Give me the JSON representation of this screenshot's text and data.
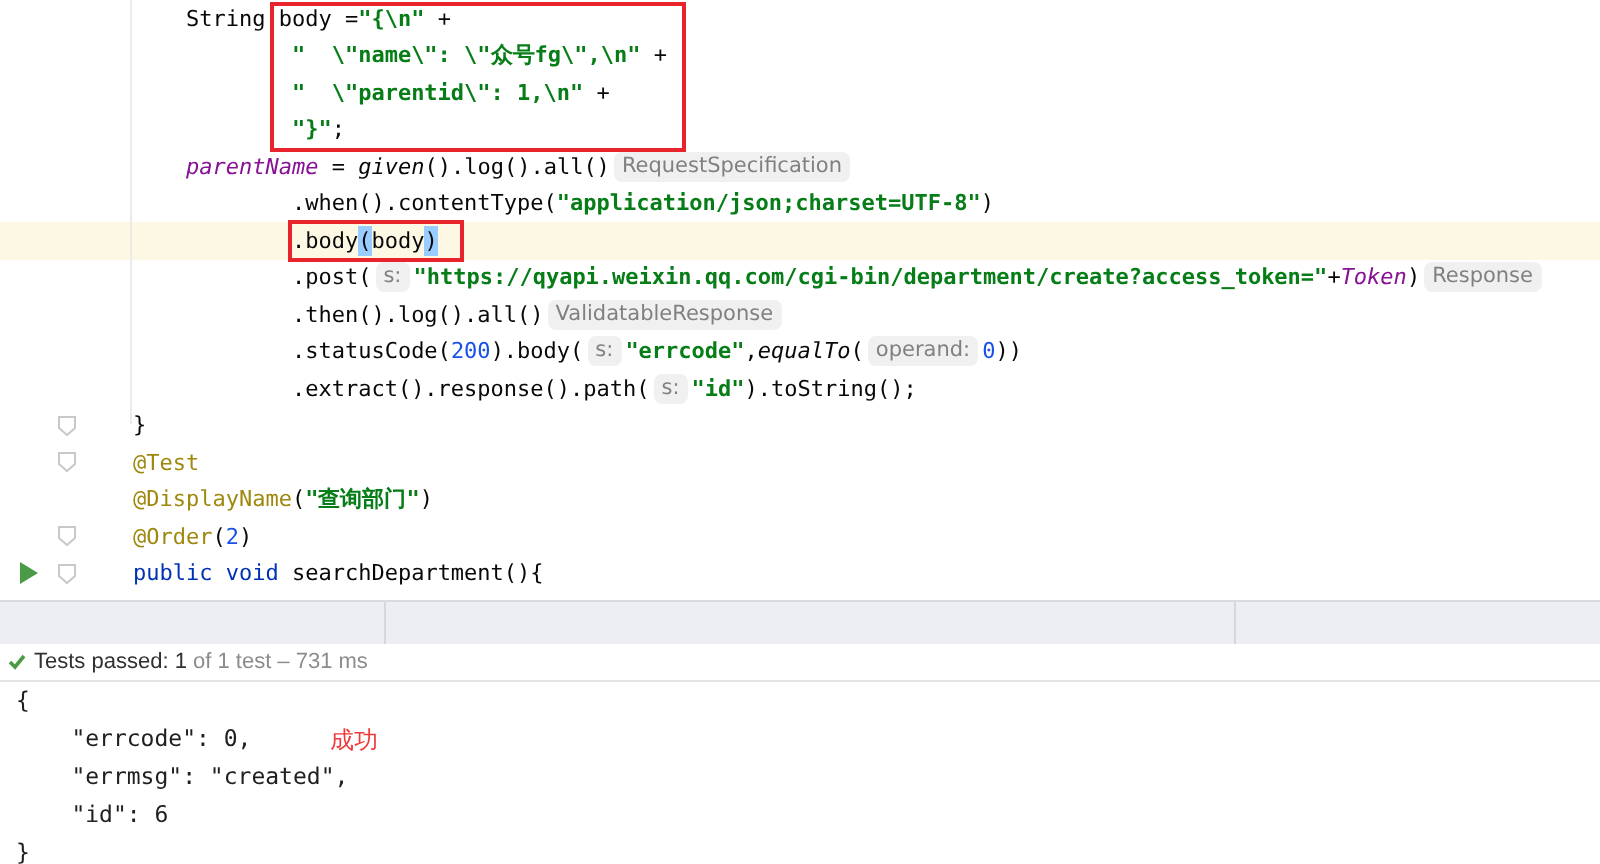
{
  "editor": {
    "lines": [
      {
        "tokens": [
          {
            "kind": "plain",
            "text": "        String body ="
          },
          {
            "kind": "string",
            "text": "\"{\\n\""
          },
          {
            "kind": "plain",
            "text": " +"
          }
        ]
      },
      {
        "tokens": [
          {
            "kind": "string",
            "text": "                \"  \\\"name\\\": \\\"众号fg\\\",\\n\""
          },
          {
            "kind": "plain",
            "text": " +"
          }
        ]
      },
      {
        "tokens": [
          {
            "kind": "string",
            "text": "                \"  \\\"parentid\\\": 1,\\n\""
          },
          {
            "kind": "plain",
            "text": " +"
          }
        ]
      },
      {
        "tokens": [
          {
            "kind": "string",
            "text": "                \"}\""
          },
          {
            "kind": "plain",
            "text": ";"
          }
        ]
      },
      {
        "tokens": [
          {
            "kind": "field",
            "text": "        parentName"
          },
          {
            "kind": "plain",
            "text": " = "
          },
          {
            "kind": "call",
            "text": "given"
          },
          {
            "kind": "plain",
            "text": "().log().all()"
          },
          {
            "kind": "hint",
            "text": "RequestSpecification"
          }
        ]
      },
      {
        "tokens": [
          {
            "kind": "plain",
            "text": "                .when().contentType("
          },
          {
            "kind": "string",
            "text": "\"application/json;charset=UTF-8\""
          },
          {
            "kind": "plain",
            "text": ")"
          }
        ]
      },
      {
        "current": true,
        "tokens": [
          {
            "kind": "plain",
            "text": "                .body"
          },
          {
            "kind": "match",
            "text": "("
          },
          {
            "kind": "plain",
            "text": "body"
          },
          {
            "kind": "match",
            "text": ")"
          }
        ]
      },
      {
        "tokens": [
          {
            "kind": "plain",
            "text": "                .post("
          },
          {
            "kind": "hint",
            "text": "s:"
          },
          {
            "kind": "string",
            "text": "\"https://qyapi.weixin.qq.com/cgi-bin/department/create?access_token=\""
          },
          {
            "kind": "plain",
            "text": "+"
          },
          {
            "kind": "field",
            "text": "Token"
          },
          {
            "kind": "plain",
            "text": ")"
          },
          {
            "kind": "hint",
            "text": "Response"
          }
        ]
      },
      {
        "tokens": [
          {
            "kind": "plain",
            "text": "                .then().log().all()"
          },
          {
            "kind": "hint",
            "text": "ValidatableResponse"
          }
        ]
      },
      {
        "tokens": [
          {
            "kind": "plain",
            "text": "                .statusCode("
          },
          {
            "kind": "number",
            "text": "200"
          },
          {
            "kind": "plain",
            "text": ").body("
          },
          {
            "kind": "hint",
            "text": "s:"
          },
          {
            "kind": "string",
            "text": "\"errcode\""
          },
          {
            "kind": "plain",
            "text": ","
          },
          {
            "kind": "call",
            "text": "equalTo"
          },
          {
            "kind": "plain",
            "text": "("
          },
          {
            "kind": "hint",
            "text": "operand:"
          },
          {
            "kind": "number",
            "text": "0"
          },
          {
            "kind": "plain",
            "text": "))"
          }
        ]
      },
      {
        "tokens": [
          {
            "kind": "plain",
            "text": "                .extract().response().path("
          },
          {
            "kind": "hint",
            "text": "s:"
          },
          {
            "kind": "string",
            "text": "\"id\""
          },
          {
            "kind": "plain",
            "text": ").toString();"
          }
        ]
      },
      {
        "foldable": true,
        "tokens": [
          {
            "kind": "plain",
            "text": "    }"
          }
        ]
      },
      {
        "foldable": true,
        "tokens": [
          {
            "kind": "annotation",
            "text": "    @Test"
          }
        ]
      },
      {
        "tokens": [
          {
            "kind": "annotation",
            "text": "    @DisplayName"
          },
          {
            "kind": "plain",
            "text": "("
          },
          {
            "kind": "string",
            "text": "\"查询部门\""
          },
          {
            "kind": "plain",
            "text": ")"
          }
        ]
      },
      {
        "foldable": true,
        "tokens": [
          {
            "kind": "annotation",
            "text": "    @Order"
          },
          {
            "kind": "plain",
            "text": "("
          },
          {
            "kind": "number",
            "text": "2"
          },
          {
            "kind": "plain",
            "text": ")"
          }
        ]
      },
      {
        "foldable": true,
        "runnable": true,
        "tokens": [
          {
            "kind": "keyword",
            "text": "    public void"
          },
          {
            "kind": "plain",
            "text": " searchDepartment(){"
          }
        ]
      }
    ]
  },
  "test_status": "**Tests passed: 1** of 1 test – 731 ms",
  "output": {
    "lines": [
      {
        "text": "{"
      },
      {
        "text": "    \"errcode\": 0,",
        "note": "成功"
      },
      {
        "text": "    \"errmsg\": \"created\","
      },
      {
        "text": "    \"id\": 6"
      },
      {
        "text": "}"
      }
    ]
  }
}
